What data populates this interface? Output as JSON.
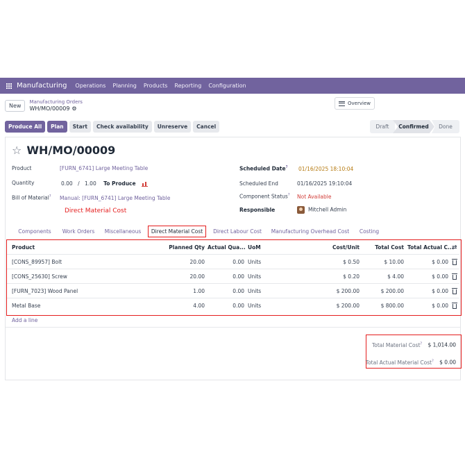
{
  "topbar": {
    "brand": "Manufacturing",
    "nav": [
      "Operations",
      "Planning",
      "Products",
      "Reporting",
      "Configuration"
    ]
  },
  "control": {
    "new_label": "New",
    "breadcrumb_parent": "Manufacturing Orders",
    "breadcrumb_current": "WH/MO/00009",
    "overview_label": "Overview"
  },
  "actions": {
    "produce_all": "Produce All",
    "plan": "Plan",
    "start": "Start",
    "check_availability": "Check availability",
    "unreserve": "Unreserve",
    "cancel": "Cancel"
  },
  "status": {
    "draft": "Draft",
    "confirmed": "Confirmed",
    "done": "Done"
  },
  "record": {
    "title": "WH/MO/00009",
    "product_label": "Product",
    "product_value": "[FURN_6741] Large Meeting Table",
    "quantity_label": "Quantity",
    "quantity_done": "0.00",
    "quantity_sep": "/",
    "quantity_total": "1.00",
    "to_produce": "To Produce",
    "bom_label": "Bill of Material",
    "bom_value": "Manual: [FURN_6741] Large Meeting Table",
    "annotation": "Direct Material Cost",
    "scheduled_date_label": "Scheduled Date",
    "scheduled_date_value": "01/16/2025 18:10:04",
    "scheduled_end_label": "Scheduled End",
    "scheduled_end_value": "01/16/2025 19:10:04",
    "component_status_label": "Component Status",
    "component_status_value": "Not Available",
    "responsible_label": "Responsible",
    "responsible_value": "Mitchell Admin",
    "help_mark": "?"
  },
  "tabs": [
    "Components",
    "Work Orders",
    "Miscellaneous",
    "Direct Material Cost",
    "Direct Labour Cost",
    "Manufacturing Overhead Cost",
    "Costing"
  ],
  "table": {
    "headers": [
      "Product",
      "Planned Qty",
      "Actual Qua...",
      "UoM",
      "Cost/Unit",
      "Total Cost",
      "Total Actual C..."
    ],
    "rows": [
      [
        "[CONS_89957] Bolt",
        "20.00",
        "0.00",
        "Units",
        "$ 0.50",
        "$ 10.00",
        "$ 0.00"
      ],
      [
        "[CONS_25630] Screw",
        "20.00",
        "0.00",
        "Units",
        "$ 0.20",
        "$ 4.00",
        "$ 0.00"
      ],
      [
        "[FURN_7023] Wood Panel",
        "1.00",
        "0.00",
        "Units",
        "$ 200.00",
        "$ 200.00",
        "$ 0.00"
      ],
      [
        "Metal Base",
        "4.00",
        "0.00",
        "Units",
        "$ 200.00",
        "$ 800.00",
        "$ 0.00"
      ]
    ],
    "add_line": "Add a line"
  },
  "totals": {
    "material_label": "Total Material Cost",
    "material_value": "$ 1,014.00",
    "actual_label": "Total Actual Material Cost",
    "actual_value": "$ 0.00"
  }
}
